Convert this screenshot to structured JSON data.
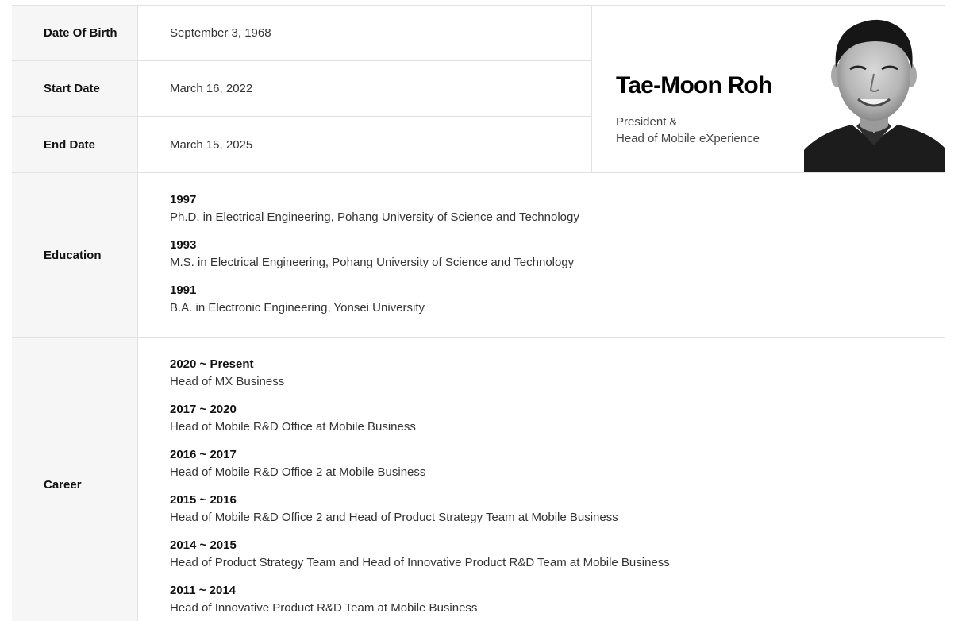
{
  "info": {
    "rows": [
      {
        "label": "Date Of Birth",
        "value": "September 3, 1968"
      },
      {
        "label": "Start Date",
        "value": "March 16, 2022"
      },
      {
        "label": "End Date",
        "value": "March 15, 2025"
      }
    ]
  },
  "profile": {
    "name": "Tae-Moon Roh",
    "title_line1": "President &",
    "title_line2": "Head of Mobile eXperience",
    "photo_icon": "portrait-photo"
  },
  "education": {
    "label": "Education",
    "entries": [
      {
        "year": "1997",
        "desc": "Ph.D. in Electrical Engineering, Pohang University of Science and Technology"
      },
      {
        "year": "1993",
        "desc": "M.S. in Electrical Engineering, Pohang University of Science and Technology"
      },
      {
        "year": "1991",
        "desc": "B.A. in Electronic Engineering, Yonsei University"
      }
    ]
  },
  "career": {
    "label": "Career",
    "entries": [
      {
        "year": "2020 ~ Present",
        "desc": "Head of MX Business"
      },
      {
        "year": "2017 ~ 2020",
        "desc": "Head of Mobile R&D Office at Mobile Business"
      },
      {
        "year": "2016 ~ 2017",
        "desc": "Head of Mobile R&D Office 2 at Mobile Business"
      },
      {
        "year": "2015 ~ 2016",
        "desc": "Head of Mobile R&D Office 2 and Head of Product Strategy Team at Mobile Business"
      },
      {
        "year": "2014 ~ 2015",
        "desc": "Head of Product Strategy Team and Head of Innovative Product R&D Team at Mobile Business"
      },
      {
        "year": "2011 ~ 2014",
        "desc": "Head of Innovative Product R&D Team at Mobile Business"
      }
    ]
  },
  "colors": {
    "label_bg": "#f6f6f6",
    "border": "#e2e2e2",
    "text_dark": "#111111"
  }
}
